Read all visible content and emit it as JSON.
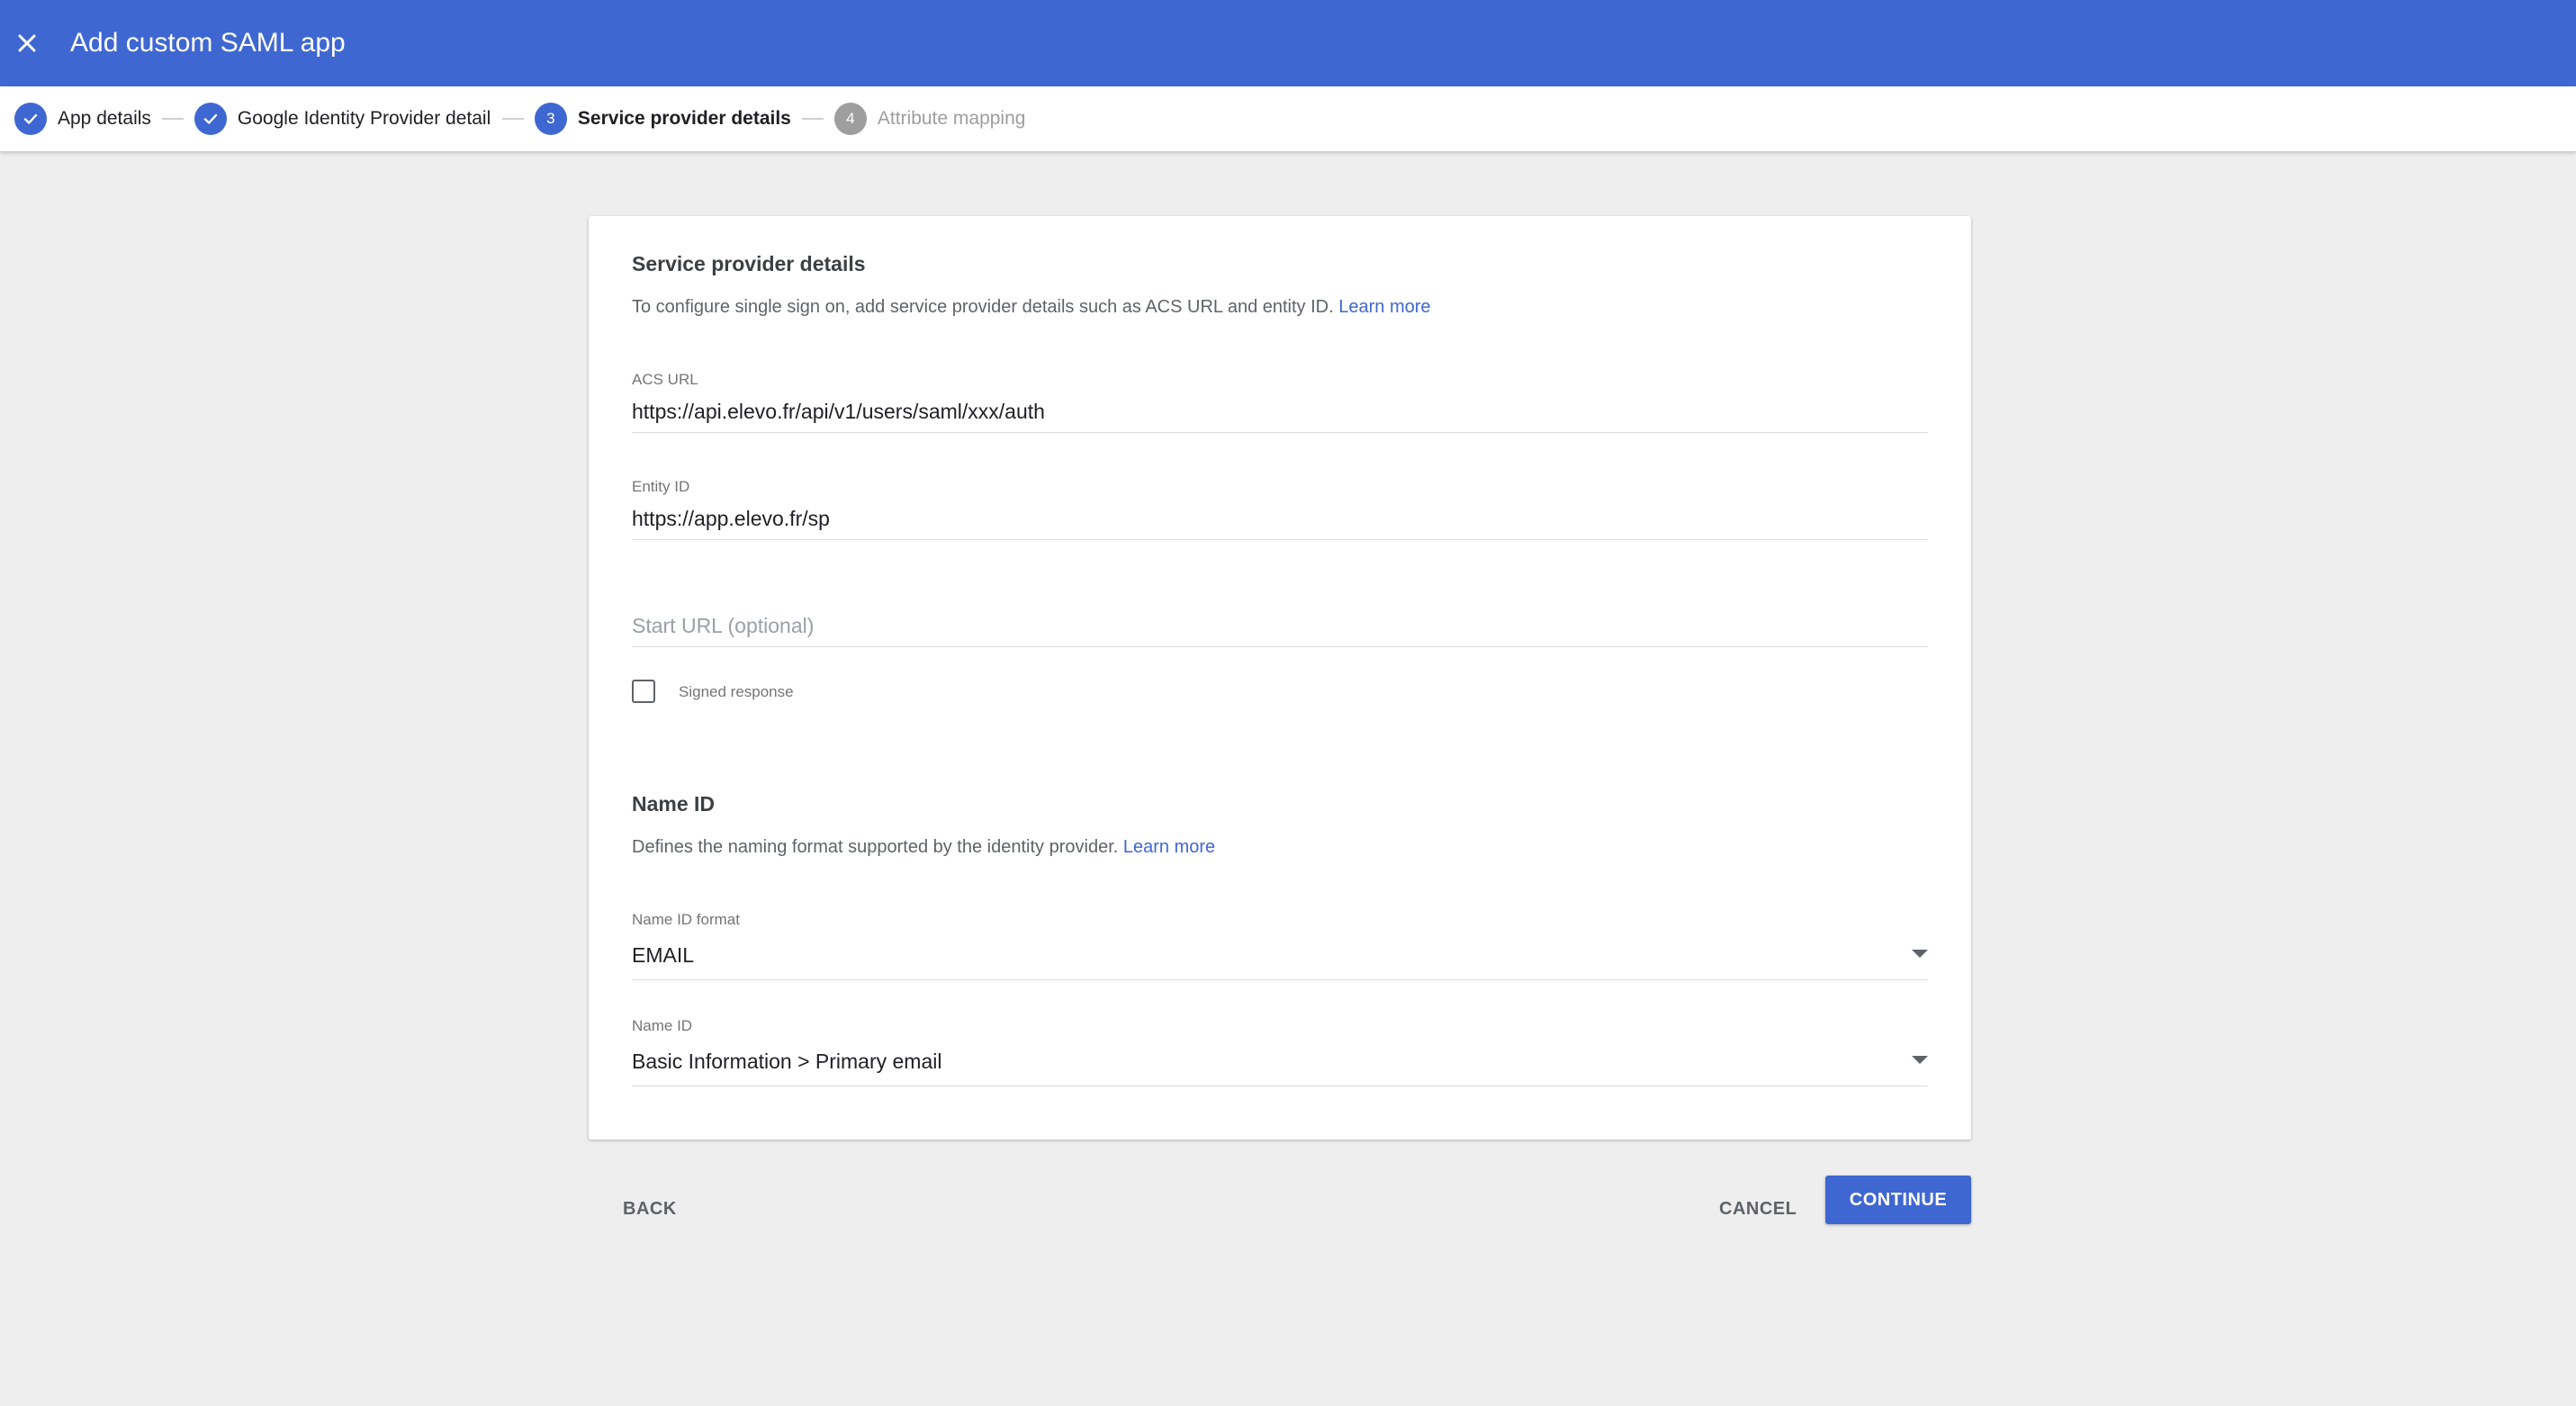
{
  "app_bar": {
    "title": "Add custom SAML app",
    "close_icon": "close-icon",
    "color": "#3f67d2"
  },
  "stepper": {
    "steps": [
      {
        "label": "App details",
        "status": "done",
        "number": "1"
      },
      {
        "label": "Google Identity Provider details",
        "status": "done",
        "number": "2"
      },
      {
        "label": "Service provider details",
        "status": "active",
        "number": "3"
      },
      {
        "label": "Attribute mapping",
        "status": "pending",
        "number": "4"
      }
    ]
  },
  "service_provider": {
    "title": "Service provider details",
    "description": "To configure single sign on, add service provider details such as ACS URL and entity ID.",
    "learn_more": "Learn more",
    "acs_url": {
      "label": "ACS URL",
      "value": "https://api.elevo.fr/api/v1/users/saml/xxx/auth"
    },
    "entity_id": {
      "label": "Entity ID",
      "value": "https://app.elevo.fr/sp"
    },
    "start_url": {
      "placeholder": "Start URL (optional)",
      "value": ""
    },
    "signed_response": {
      "label": "Signed response",
      "checked": false
    }
  },
  "name_id_section": {
    "title": "Name ID",
    "description": "Defines the naming format supported by the identity provider.",
    "learn_more": "Learn more",
    "name_id_format": {
      "label": "Name ID format",
      "value": "EMAIL"
    },
    "name_id": {
      "label": "Name ID",
      "value": "Basic Information > Primary email"
    }
  },
  "actions": {
    "back": "BACK",
    "cancel": "CANCEL",
    "continue": "CONTINUE"
  }
}
